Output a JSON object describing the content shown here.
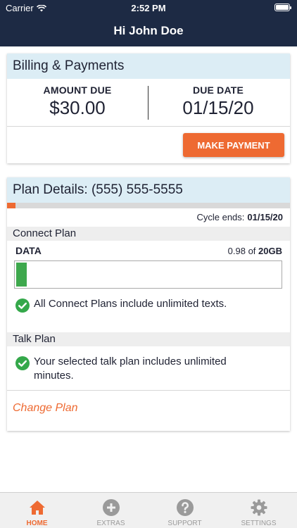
{
  "status_bar": {
    "carrier": "Carrier",
    "time": "2:52 PM"
  },
  "header": {
    "greeting": "Hi John Doe"
  },
  "billing": {
    "title": "Billing & Payments",
    "amount_due_label": "AMOUNT DUE",
    "amount_due_value": "$30.00",
    "due_date_label": "DUE DATE",
    "due_date_value": "01/15/20",
    "make_payment_label": "MAKE PAYMENT"
  },
  "plan": {
    "title": "Plan Details: (555) 555-5555",
    "cycle_progress": 0.03,
    "cycle_ends_label": "Cycle ends:",
    "cycle_ends_value": "01/15/20",
    "connect_plan_label": "Connect Plan",
    "data_label": "DATA",
    "data_used": "0.98",
    "data_of": "of",
    "data_total": "20GB",
    "data_fraction": 0.049,
    "connect_feature": "All Connect Plans include unlimited texts.",
    "talk_plan_label": "Talk Plan",
    "talk_feature": "Your selected talk plan includes unlimited minutes.",
    "change_plan_label": "Change Plan"
  },
  "colors": {
    "navy": "#1d2a44",
    "accent": "#ee6a32",
    "green": "#34a84a",
    "card_header": "#dcedf5"
  },
  "tabbar": {
    "items": [
      {
        "label": "HOME",
        "icon": "home-icon",
        "active": true
      },
      {
        "label": "EXTRAS",
        "icon": "plus-circle-icon",
        "active": false
      },
      {
        "label": "SUPPORT",
        "icon": "question-circle-icon",
        "active": false
      },
      {
        "label": "SETTINGS",
        "icon": "gear-icon",
        "active": false
      }
    ]
  }
}
